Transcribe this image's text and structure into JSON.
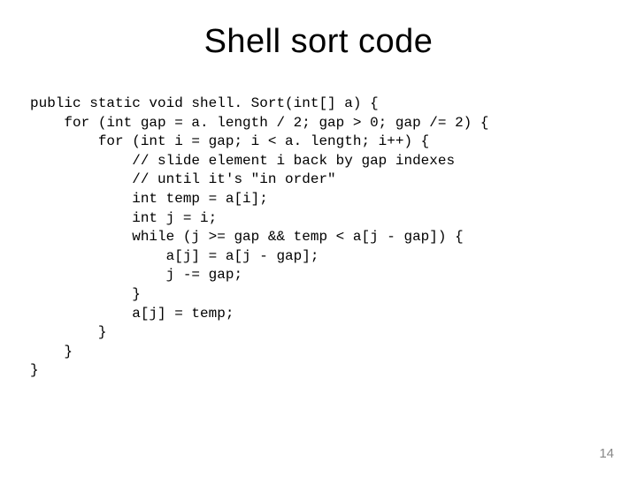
{
  "title": "Shell sort code",
  "code_lines": [
    "public static void shell. Sort(int[] a) {",
    "    for (int gap = a. length / 2; gap > 0; gap /= 2) {",
    "        for (int i = gap; i < a. length; i++) {",
    "            // slide element i back by gap indexes",
    "            // until it's \"in order\"",
    "            int temp = a[i];",
    "            int j = i;",
    "            while (j >= gap && temp < a[j - gap]) {",
    "                a[j] = a[j - gap];",
    "                j -= gap;",
    "            }",
    "            a[j] = temp;",
    "        }",
    "    }",
    "}"
  ],
  "page_number": "14"
}
